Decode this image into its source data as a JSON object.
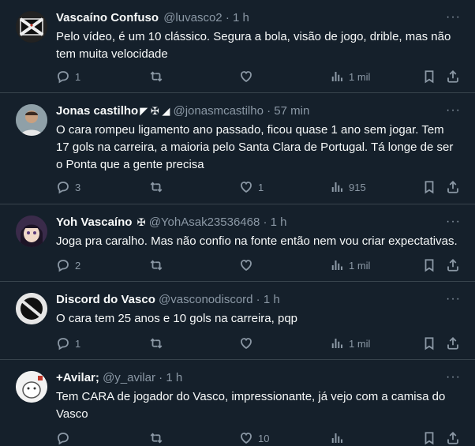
{
  "tweets": [
    {
      "name": "Vascaíno Confuso",
      "badges": "",
      "handle": "@luvasco2",
      "time": "1 h",
      "text": "Pelo vídeo, é um 10 clássico. Segura a bola, visão de jogo, drible, mas não tem muita velocidade",
      "replies": "1",
      "retweets": "",
      "likes": "",
      "views": "1 mil"
    },
    {
      "name": "Jonas castilho",
      "badges": "◤ ✠ ◢",
      "handle": "@jonasmcastilho",
      "time": "57 min",
      "text": "O cara rompeu ligamento ano passado, ficou quase 1 ano sem jogar. Tem 17 gols na carreira, a maioria pelo Santa Clara de Portugal. Tá longe de ser o Ponta que a gente precisa",
      "replies": "3",
      "retweets": "",
      "likes": "1",
      "views": "915"
    },
    {
      "name": "Yoh Vascaíno",
      "badges": "✠",
      "handle": "@YohAsak23536468",
      "time": "1 h",
      "text": "Joga pra caralho. Mas não confio na fonte então nem vou criar expectativas.",
      "replies": "2",
      "retweets": "",
      "likes": "",
      "views": "1 mil"
    },
    {
      "name": "Discord do Vasco",
      "badges": "",
      "handle": "@vasconodiscord",
      "time": "1 h",
      "text": "O cara tem 25 anos e 10 gols na carreira, pqp",
      "replies": "1",
      "retweets": "",
      "likes": "",
      "views": "1 mil"
    },
    {
      "name": "+Avilar;",
      "badges": "",
      "handle": "@y_avilar",
      "time": "1 h",
      "text": "Tem CARA de jogador do Vasco, impressionante, já vejo com a camisa do Vasco",
      "replies": "",
      "retweets": "",
      "likes": "10",
      "views": ""
    }
  ],
  "separator": "·",
  "more_label": "···",
  "colors": {
    "background": "#15202b",
    "text": "#f7f9f9",
    "muted": "#8b98a5",
    "border": "#38444d"
  }
}
